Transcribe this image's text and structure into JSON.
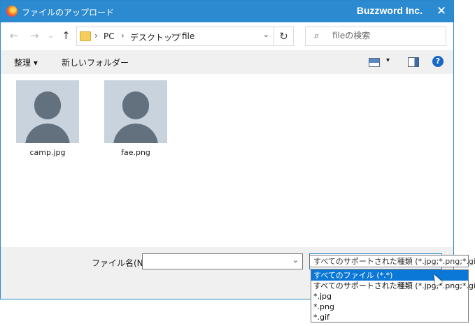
{
  "window": {
    "title": "ファイルのアップロード",
    "brand": "Buzzword Inc.",
    "close_glyph": "✕"
  },
  "nav": {
    "back_glyph": "←",
    "forward_glyph": "→",
    "recent_glyph": "⌄",
    "up_glyph": "↑",
    "breadcrumb": [
      "PC",
      "デスクトップ",
      "file"
    ],
    "separator": "›",
    "dropdown_glyph": "⌄",
    "refresh_glyph": "↻",
    "search_icon": "⌕",
    "search_placeholder": "fileの検索"
  },
  "toolbar": {
    "organize_label": "整理 ▾",
    "new_folder_label": "新しいフォルダー",
    "view_dropdown_glyph": "▾",
    "help_glyph": "?"
  },
  "files": [
    {
      "name": "camp.jpg"
    },
    {
      "name": "fae.png"
    }
  ],
  "bottom": {
    "filename_label": "ファイル名(N):",
    "filename_value": "",
    "combo_glyph": "⌄"
  },
  "file_type": {
    "tooltip": "すべてのサポートされた種類 (*.jpg;*.png;*.gif)",
    "options": [
      "すべてのファイル (*.*)",
      "すべてのサポートされた種類 (*.jpg;*.png;*.gif)",
      "*.jpg",
      "*.png",
      "*.gif"
    ],
    "selected_index": 0
  },
  "colors": {
    "titlebar": "#2b8ad0",
    "selection": "#0b78d7",
    "toolbar_bg": "#f0f0f0"
  }
}
